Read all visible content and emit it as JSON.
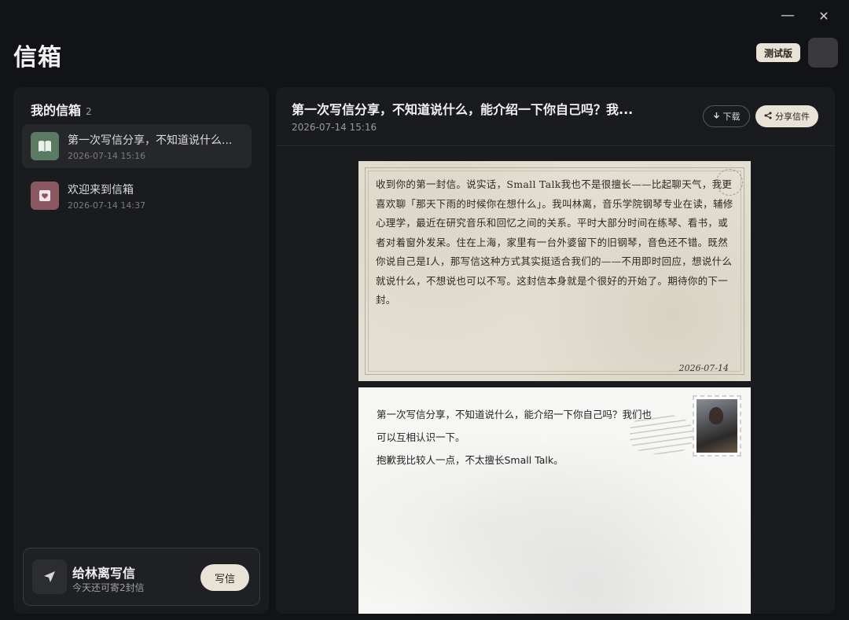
{
  "app": {
    "title": "信箱",
    "beta_badge": "测试版"
  },
  "window": {
    "minimize_glyph": "—",
    "close_glyph": "✕"
  },
  "sidebar": {
    "title": "我的信箱",
    "count": "2",
    "items": [
      {
        "title": "第一次写信分享，不知道说什么...",
        "date": "2026-07-14 15:16",
        "icon": "book-icon",
        "color": "#5b7a62",
        "active": true
      },
      {
        "title": "欢迎来到信箱",
        "date": "2026-07-14 14:37",
        "icon": "heart-icon",
        "color": "#8b5862",
        "active": false
      }
    ],
    "compose": {
      "title": "给林离写信",
      "subtitle": "今天还可寄2封信",
      "button": "写信"
    }
  },
  "letter": {
    "title": "第一次写信分享，不知道说什么，能介绍一下你自己吗？我...",
    "date": "2026-07-14 15:16",
    "download_label": "下载",
    "share_label": "分享信件",
    "reply": {
      "body": "收到你的第一封信。说实话，Small Talk我也不是很擅长——比起聊天气，我更喜欢聊「那天下雨的时候你在想什么」。我叫林离，音乐学院钢琴专业在读，辅修心理学，最近在研究音乐和回忆之间的关系。平时大部分时间在练琴、看书，或者对着窗外发呆。住在上海，家里有一台外婆留下的旧钢琴，音色还不错。既然你说自己是I人，那写信这种方式其实挺适合我们的——不用即时回应，想说什么就说什么，不想说也可以不写。这封信本身就是个很好的开始了。期待你的下一封。",
      "date": "2026-07-14"
    },
    "original": {
      "lines": [
        "第一次写信分享，不知道说什么，能介绍一下你自己吗？我们也",
        "可以互相认识一下。",
        "抱歉我比较人一点，不太擅长Small Talk。"
      ]
    }
  }
}
